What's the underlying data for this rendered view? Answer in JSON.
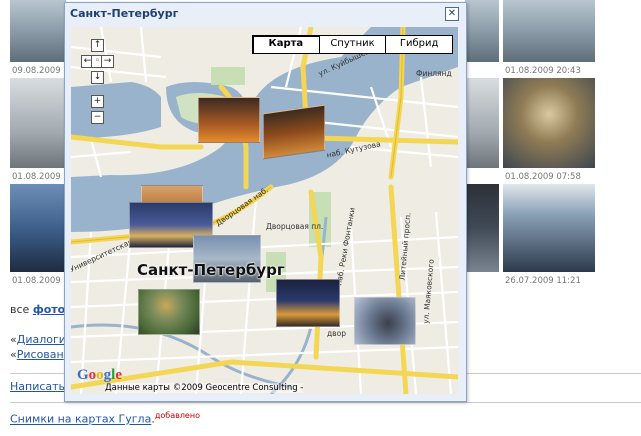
{
  "gallery": {
    "dates": {
      "d1": "09.08.2009",
      "d2": "01.08.2009  20:43",
      "d3": "01.08.2009",
      "d4": "01.08.2009  07:58",
      "d5": "01.08.2009",
      "d6": "26.07.2009  11:21"
    }
  },
  "page": {
    "all_prefix": "все",
    "all_link": "фотог",
    "links": [
      "Диалоги",
      "Рисован"
    ],
    "write_link": "Написать",
    "maps_link": "Снимки на картах Гугла",
    "added": "добавлено"
  },
  "popup": {
    "title": "Санкт-Петербург",
    "close": "✕"
  },
  "map": {
    "types": [
      "Карта",
      "Спутник",
      "Гибрид"
    ],
    "selected_type": "Карта",
    "city_label": "Санкт-Петербург",
    "logo": "Google",
    "copyright": "Данные карты ©2009 Geocentre Consulting -",
    "street_labels": {
      "kutuzova": "наб. Кутузова",
      "dvortsovaya": "Дворцовая наб.",
      "griboyedova": "наб. Реки Фонтанки",
      "liteyny": "Литейный просп.",
      "mayakovskogo": "ул. Маяковского",
      "vasil": "Университетская наб.",
      "kuybysheva": "ул. Куйбышева",
      "finl": "Финлянд",
      "dvor": "двор",
      "pl": "Дворцовая пл."
    },
    "icons": {
      "up": "up-arrow-icon",
      "down": "down-arrow-icon",
      "left": "left-arrow-icon",
      "right": "right-arrow-icon",
      "center": "center-icon",
      "zoom_in": "plus-icon",
      "zoom_out": "minus-icon"
    }
  }
}
